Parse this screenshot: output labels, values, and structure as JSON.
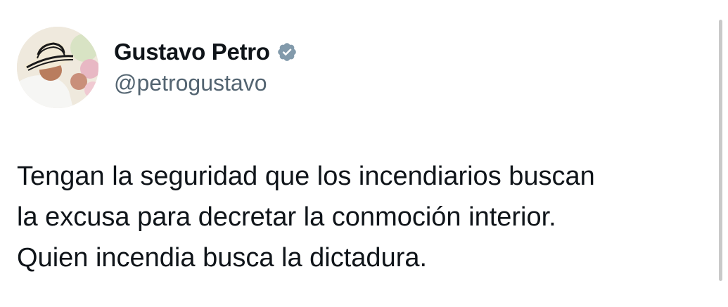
{
  "author": {
    "display_name": "Gustavo Petro",
    "handle": "@petrogustavo",
    "verified": true,
    "avatar_icon": "profile-photo-sombrero-vueltiao"
  },
  "tweet": {
    "lines": [
      "Tengan la seguridad que los incendiarios buscan",
      "la excusa para decretar la conmoción interior.",
      "Quien incendia busca la dictadura."
    ]
  },
  "colors": {
    "text": "#0f1419",
    "secondary_text": "#536471",
    "verified_badge": "#829aab",
    "background": "#ffffff"
  }
}
